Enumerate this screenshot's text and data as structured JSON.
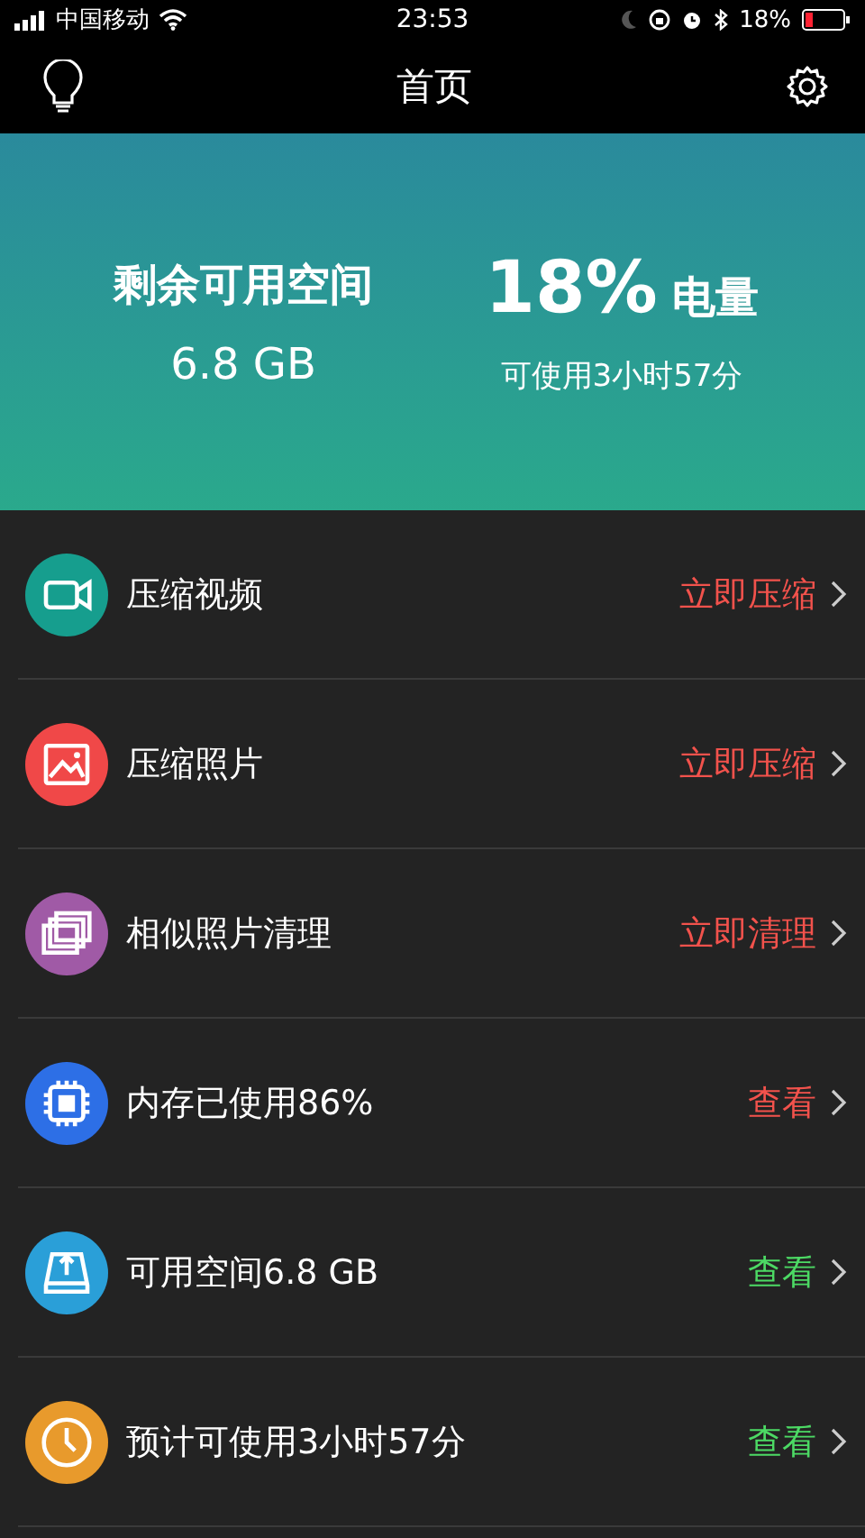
{
  "status_bar": {
    "carrier": "中国移动",
    "time": "23:53",
    "battery": "18%"
  },
  "nav": {
    "title": "首页"
  },
  "hero": {
    "storage_label": "剩余可用空间",
    "storage_value": "6.8 GB",
    "battery_value": "18%",
    "battery_label": "电量",
    "battery_time": "可使用3小时57分"
  },
  "items": [
    {
      "kind": "video",
      "color": "#169e8e",
      "label": "压缩视频",
      "action": {
        "text": "立即压缩",
        "color": "#f2524c"
      }
    },
    {
      "kind": "photo",
      "color": "#f04848",
      "label": "压缩照片",
      "action": {
        "text": "立即压缩",
        "color": "#f2524c"
      }
    },
    {
      "kind": "photos",
      "color": "#a05aa6",
      "label": "相似照片清理",
      "action": {
        "text": "立即清理",
        "color": "#f2524c"
      }
    },
    {
      "kind": "chip",
      "color": "#2d6fe6",
      "label": "内存已使用86%",
      "action": {
        "text": "查看",
        "color": "#f2524c"
      }
    },
    {
      "kind": "disk",
      "color": "#2a9fd8",
      "label": "可用空间6.8 GB",
      "action": {
        "text": "查看",
        "color": "#4cd964"
      }
    },
    {
      "kind": "clock",
      "color": "#e89a2c",
      "label": "预计可使用3小时57分",
      "action": {
        "text": "查看",
        "color": "#4cd964"
      }
    }
  ]
}
